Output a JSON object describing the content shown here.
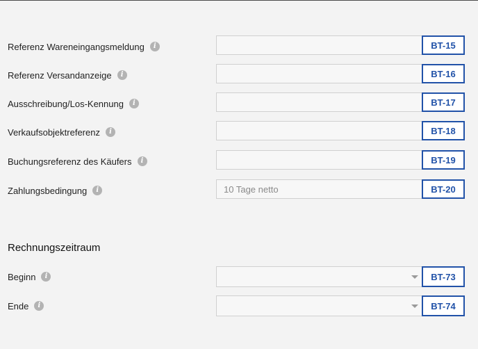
{
  "fields": [
    {
      "label": "Referenz Wareneingangsmeldung",
      "value": "",
      "placeholder": "",
      "code": "BT-15"
    },
    {
      "label": "Referenz Versandanzeige",
      "value": "",
      "placeholder": "",
      "code": "BT-16"
    },
    {
      "label": "Ausschreibung/Los-Kennung",
      "value": "",
      "placeholder": "",
      "code": "BT-17"
    },
    {
      "label": "Verkaufsobjektreferenz",
      "value": "",
      "placeholder": "",
      "code": "BT-18"
    },
    {
      "label": "Buchungsreferenz des Käufers",
      "value": "",
      "placeholder": "",
      "code": "BT-19"
    },
    {
      "label": "Zahlungsbedingung",
      "value": "",
      "placeholder": "10 Tage netto",
      "code": "BT-20"
    }
  ],
  "period": {
    "title": "Rechnungszeitraum",
    "start": {
      "label": "Beginn",
      "value": "",
      "code": "BT-73"
    },
    "end": {
      "label": "Ende",
      "value": "",
      "code": "BT-74"
    }
  },
  "icons": {
    "info": "info-icon",
    "dropdown": "chevron-down-icon"
  },
  "colors": {
    "accent": "#2152a8",
    "background": "#f3f3f3",
    "field_border": "#d0d0d0",
    "info_icon": "#b3b3b3"
  }
}
